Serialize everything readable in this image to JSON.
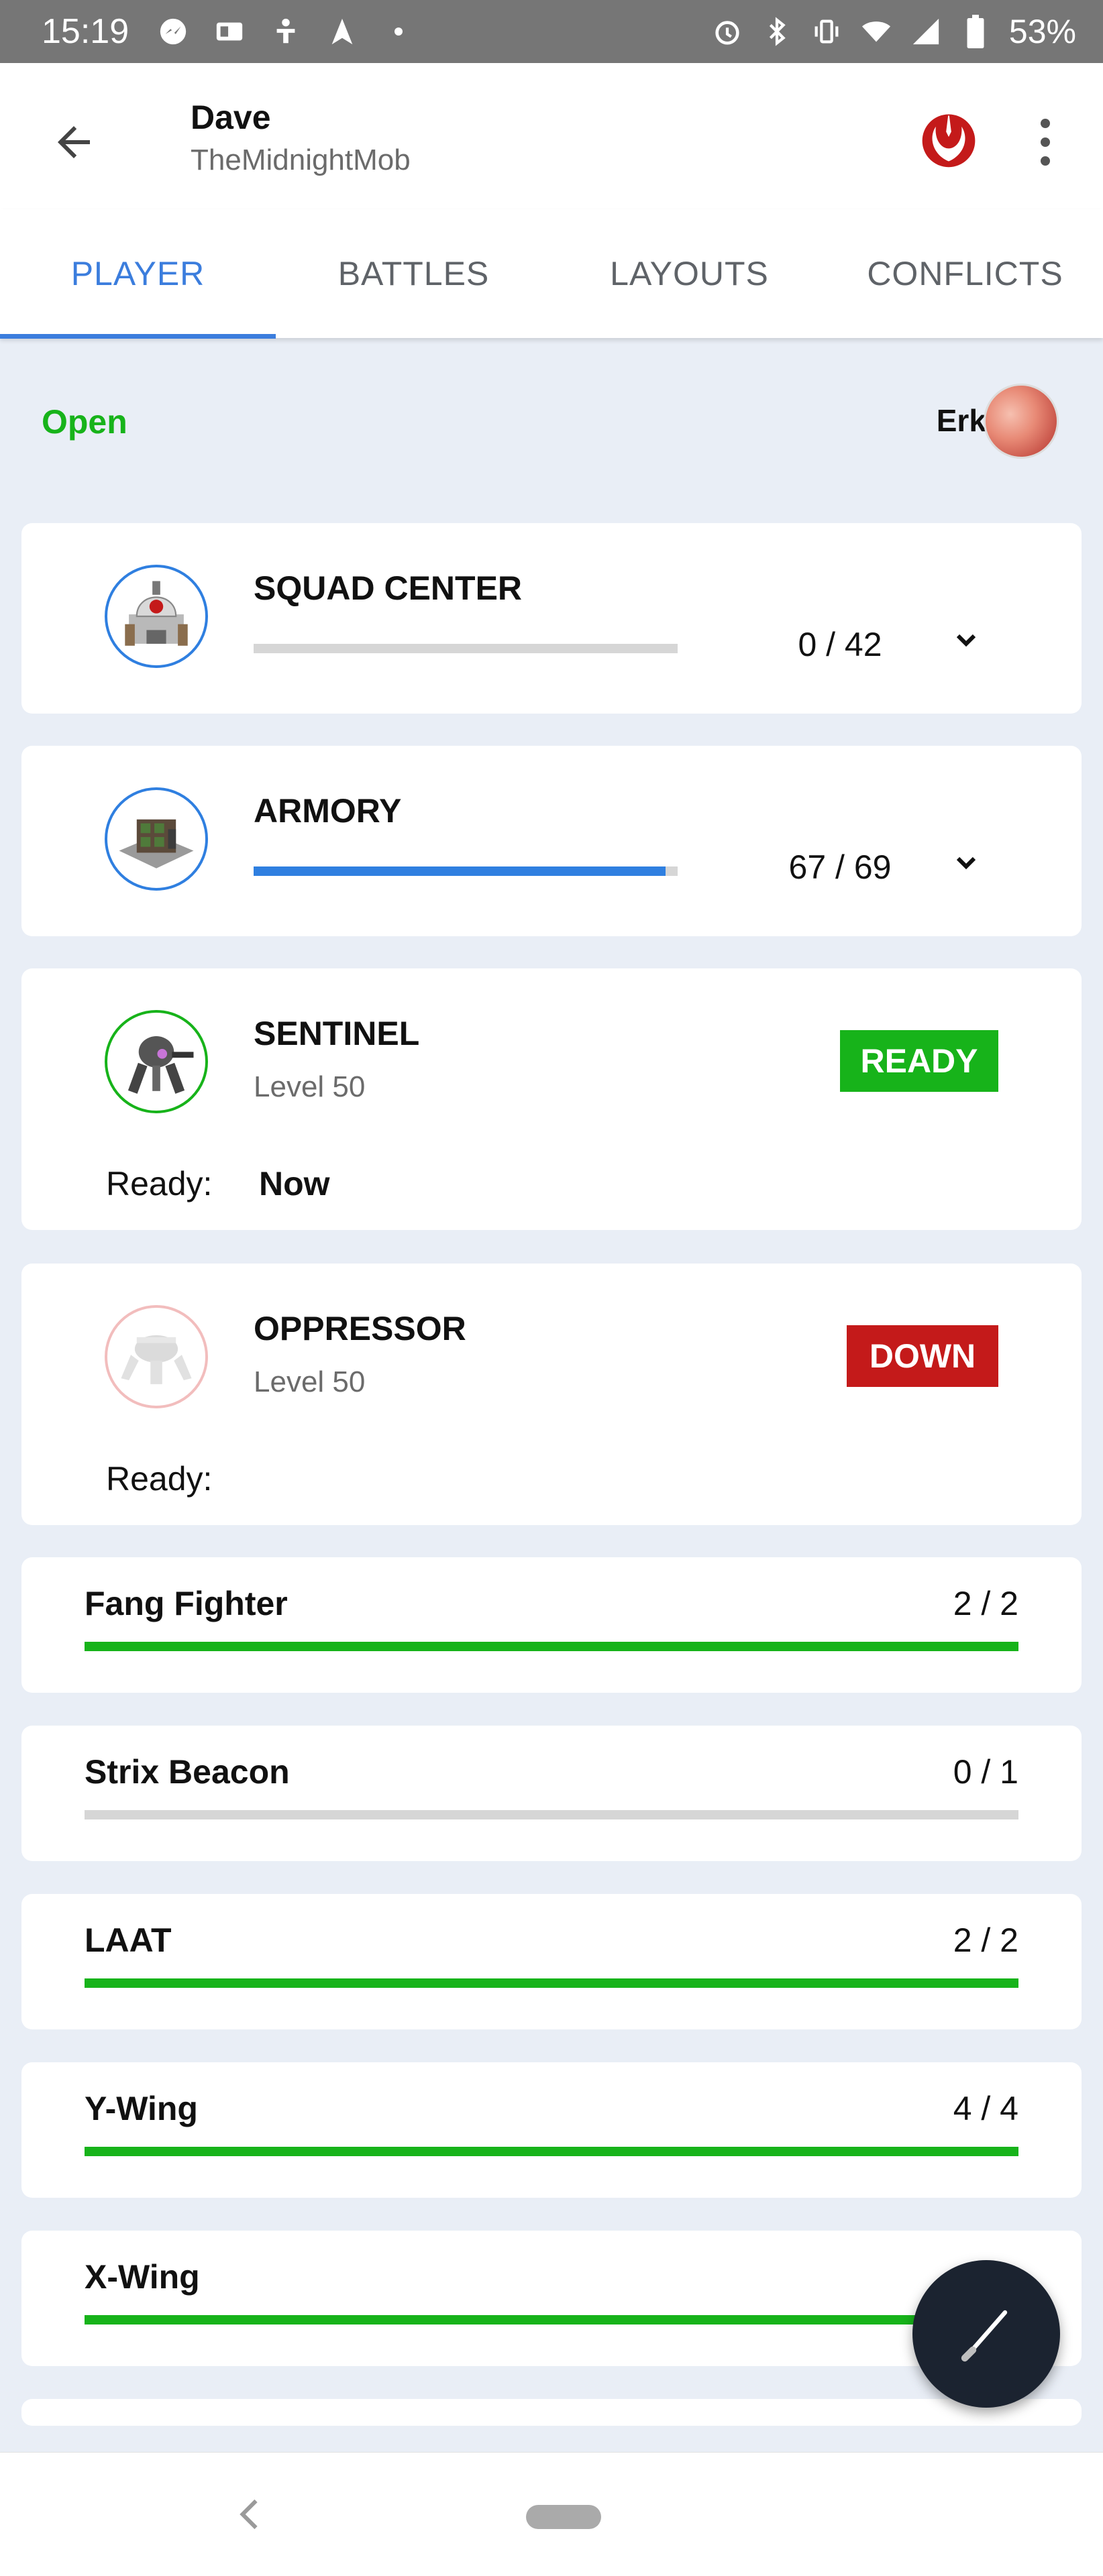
{
  "status_bar": {
    "time": "15:19",
    "battery": "53%"
  },
  "header": {
    "name": "Dave",
    "subtitle": "TheMidnightMob",
    "faction_icon": "rebel-alliance-icon"
  },
  "tabs": [
    {
      "label": "PLAYER",
      "active": true
    },
    {
      "label": "BATTLES",
      "active": false
    },
    {
      "label": "LAYOUTS",
      "active": false
    },
    {
      "label": "CONFLICTS",
      "active": false
    }
  ],
  "status": {
    "label": "Open",
    "color": "#17b31a",
    "owner": "Erkit"
  },
  "buildings": [
    {
      "name": "SQUAD CENTER",
      "count": "0 / 42",
      "progress": 0
    },
    {
      "name": "ARMORY",
      "count": "67 / 69",
      "progress": 0.971
    }
  ],
  "defenses": [
    {
      "name": "SENTINEL",
      "level": "Level 50",
      "status": "READY",
      "ready_label": "Ready:",
      "ready_value": "Now"
    },
    {
      "name": "OPPRESSOR",
      "level": "Level 50",
      "status": "DOWN",
      "ready_label": "Ready:",
      "ready_value": ""
    }
  ],
  "units": [
    {
      "name": "Fang Fighter",
      "count": "2 / 2",
      "progress": 1
    },
    {
      "name": "Strix Beacon",
      "count": "0 / 1",
      "progress": 0
    },
    {
      "name": "LAAT",
      "count": "2 / 2",
      "progress": 1
    },
    {
      "name": "Y-Wing",
      "count": "4 / 4",
      "progress": 1
    },
    {
      "name": "X-Wing",
      "count": "",
      "progress": 1
    }
  ],
  "colors": {
    "accent": "#3b7ddd",
    "ready": "#17b31a",
    "down": "#c41a1a",
    "fab": "#1b2330"
  }
}
